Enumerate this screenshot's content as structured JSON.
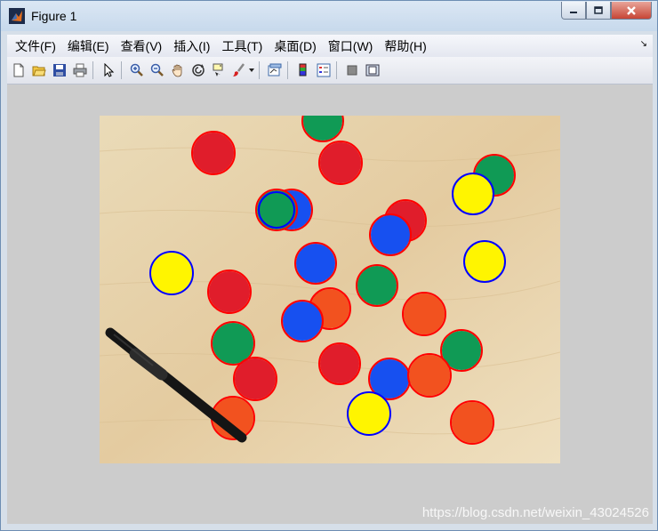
{
  "window": {
    "title": "Figure 1",
    "minimize_label": "minimize",
    "maximize_label": "maximize",
    "close_label": "close"
  },
  "menubar": {
    "items": [
      "文件(F)",
      "编辑(E)",
      "查看(V)",
      "插入(I)",
      "工具(T)",
      "桌面(D)",
      "窗口(W)",
      "帮助(H)"
    ]
  },
  "toolbar": {
    "buttons": [
      {
        "icon": "new-figure-icon"
      },
      {
        "icon": "open-file-icon"
      },
      {
        "icon": "save-icon"
      },
      {
        "icon": "print-icon"
      },
      {
        "icon": "edit-plot-arrow-icon"
      },
      {
        "icon": "zoom-in-icon"
      },
      {
        "icon": "zoom-out-icon"
      },
      {
        "icon": "pan-hand-icon"
      },
      {
        "icon": "rotate-3d-icon"
      },
      {
        "icon": "data-cursor-icon"
      },
      {
        "icon": "brush-icon"
      },
      {
        "icon": "link-plot-icon"
      },
      {
        "icon": "insert-colorbar-icon"
      },
      {
        "icon": "insert-legend-icon"
      },
      {
        "icon": "hide-plot-tools-icon"
      },
      {
        "icon": "show-plot-tools-icon"
      }
    ]
  },
  "image": {
    "description_colors": {
      "background": "#e6cfa6",
      "red": "#e01d2b",
      "green": "#109a55",
      "blue": "#1750f0",
      "yellow": "#fff500",
      "orange": "#f2521f",
      "detect_red": "#ff0000",
      "detect_blue": "#0000ff"
    }
  },
  "watermark": "https://blog.csdn.net/weixin_43024526"
}
